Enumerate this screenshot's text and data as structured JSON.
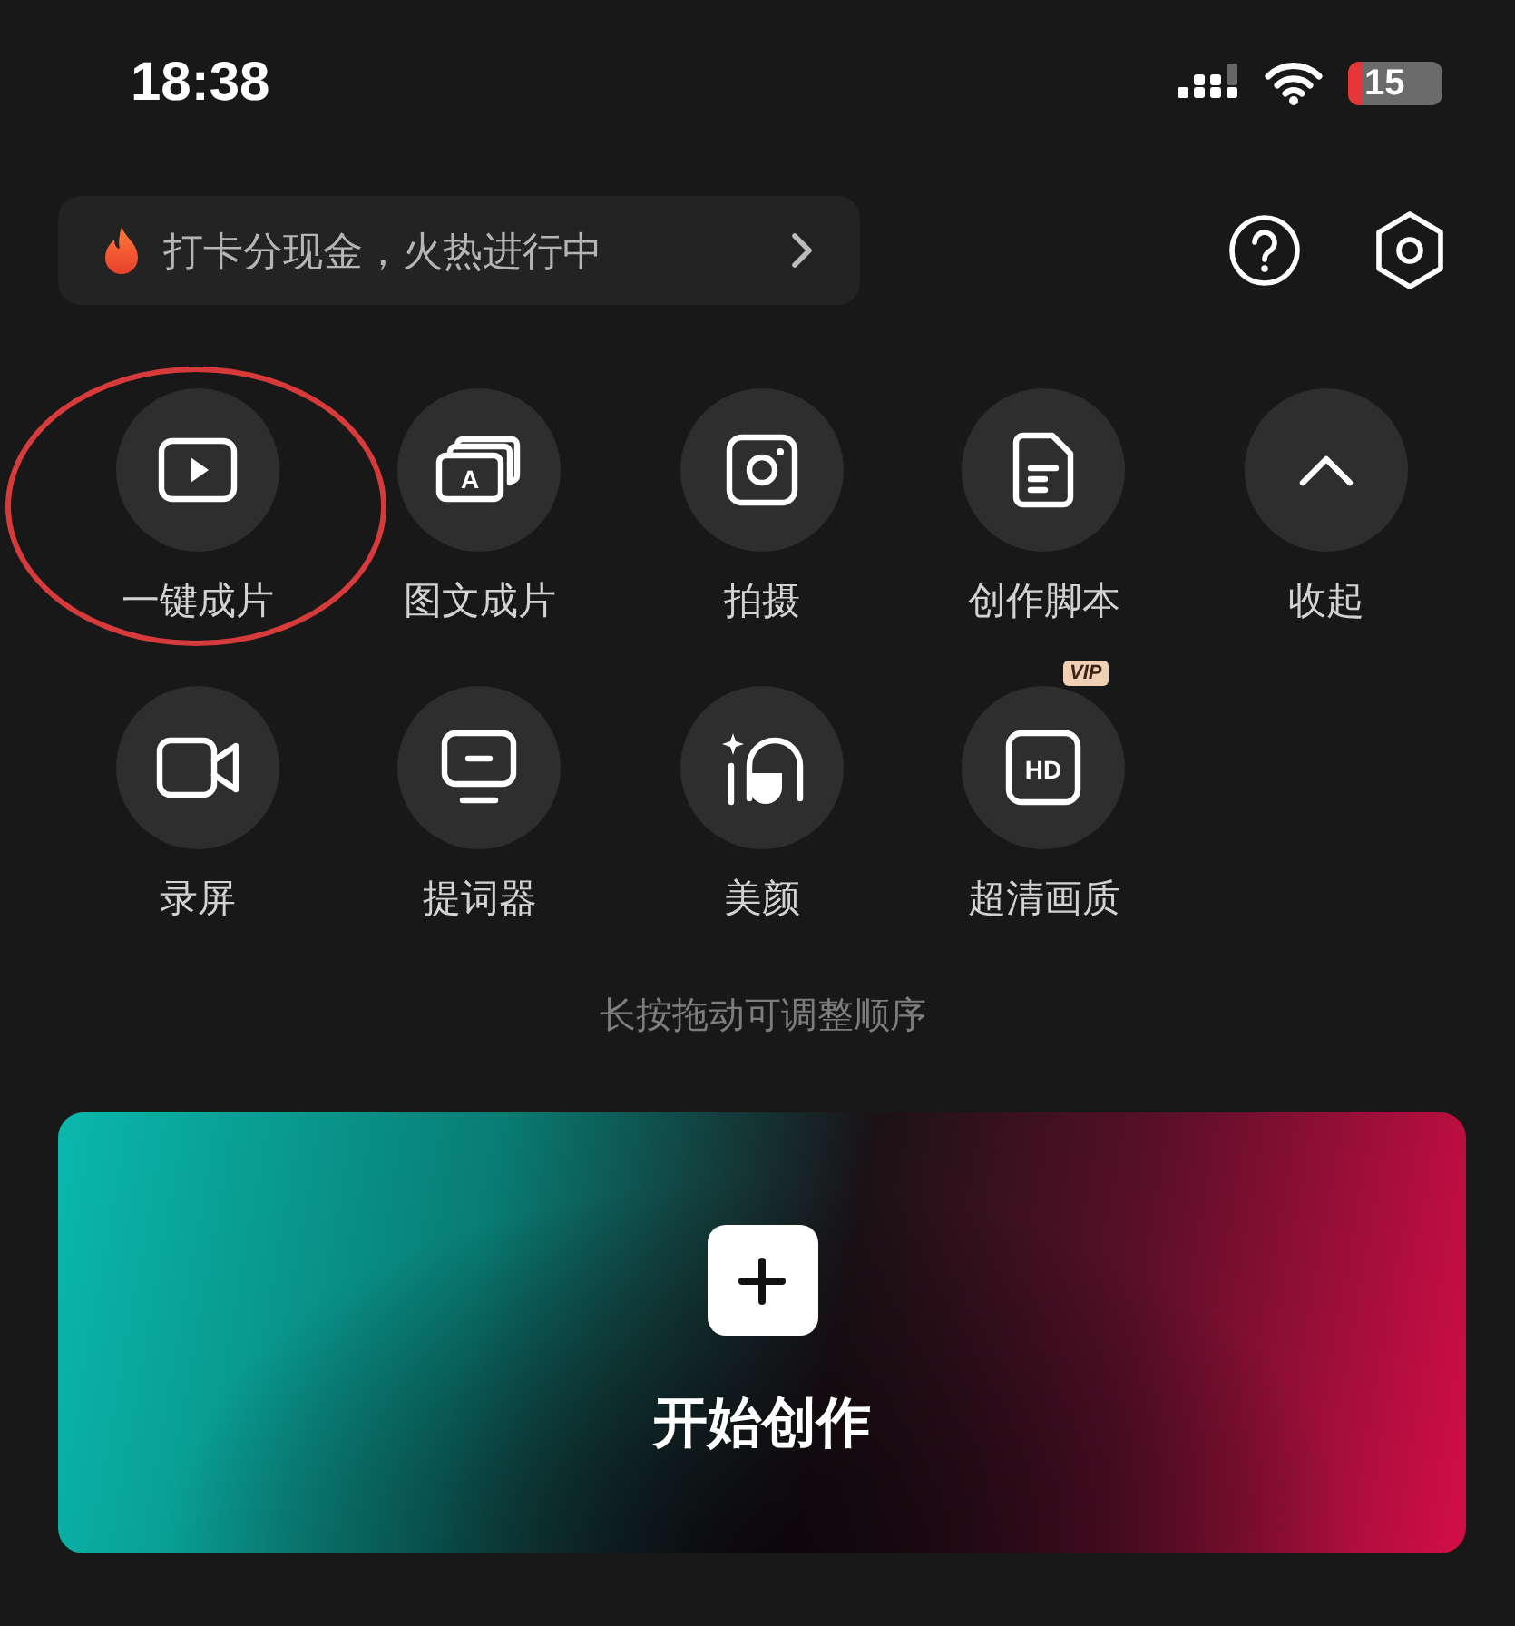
{
  "status_bar": {
    "time": "18:38",
    "battery": "15"
  },
  "promo_banner": {
    "text": "打卡分现金，火热进行中"
  },
  "tools": [
    {
      "kind": "oneclick",
      "label": "一键成片",
      "circled": true
    },
    {
      "kind": "imagetext",
      "label": "图文成片",
      "icon_text": "A",
      "circled": false
    },
    {
      "kind": "camera",
      "label": "拍摄",
      "circled": false
    },
    {
      "kind": "script",
      "label": "创作脚本",
      "circled": false
    },
    {
      "kind": "collapse",
      "label": "收起",
      "circled": false
    },
    {
      "kind": "record",
      "label": "录屏",
      "circled": false
    },
    {
      "kind": "prompter",
      "label": "提词器",
      "circled": false
    },
    {
      "kind": "beauty",
      "label": "美颜",
      "circled": false
    },
    {
      "kind": "hd",
      "label": "超清画质",
      "icon_text": "HD",
      "badge": "VIP",
      "circled": false
    }
  ],
  "hint": "长按拖动可调整顺序",
  "create_card": {
    "label": "开始创作"
  }
}
